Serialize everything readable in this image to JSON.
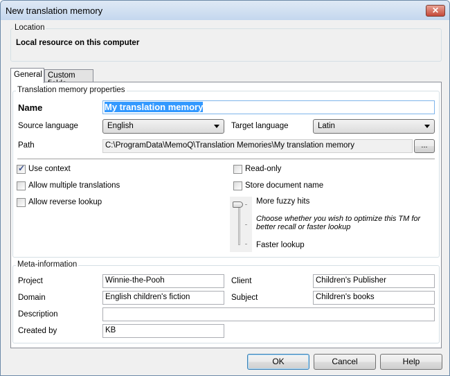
{
  "window": {
    "title": "New translation memory",
    "close_icon": "close-icon"
  },
  "location": {
    "label": "Location",
    "value": "Local resource on this computer"
  },
  "tabs": [
    {
      "label": "General",
      "active": true
    },
    {
      "label": "Custom fields",
      "active": false
    }
  ],
  "properties": {
    "label": "Translation memory properties",
    "name_label": "Name",
    "name_value": "My translation memory",
    "source_label": "Source language",
    "source_value": "English",
    "target_label": "Target language",
    "target_value": "Latin",
    "path_label": "Path",
    "path_value": "C:\\ProgramData\\MemoQ\\Translation Memories\\My translation memory",
    "browse_label": "...",
    "checkboxes": [
      {
        "label": "Use context",
        "checked": true
      },
      {
        "label": "Allow multiple translations",
        "checked": false
      },
      {
        "label": "Allow reverse lookup",
        "checked": false
      },
      {
        "label": "Read-only",
        "checked": false
      },
      {
        "label": "Store document name",
        "checked": false
      }
    ],
    "slider": {
      "top_label": "More fuzzy hits",
      "bottom_label": "Faster lookup",
      "hint": "Choose whether you wish to optimize this TM for better recall or faster lookup",
      "value": "More fuzzy hits",
      "ticks": 3
    }
  },
  "meta": {
    "label": "Meta-information",
    "project_label": "Project",
    "project_value": "Winnie-the-Pooh",
    "client_label": "Client",
    "client_value": "Children's Publisher",
    "domain_label": "Domain",
    "domain_value": "English children's fiction",
    "subject_label": "Subject",
    "subject_value": "Children's books",
    "description_label": "Description",
    "description_value": "",
    "created_by_label": "Created by",
    "created_by_value": "KB"
  },
  "buttons": {
    "ok": "OK",
    "cancel": "Cancel",
    "help": "Help"
  }
}
